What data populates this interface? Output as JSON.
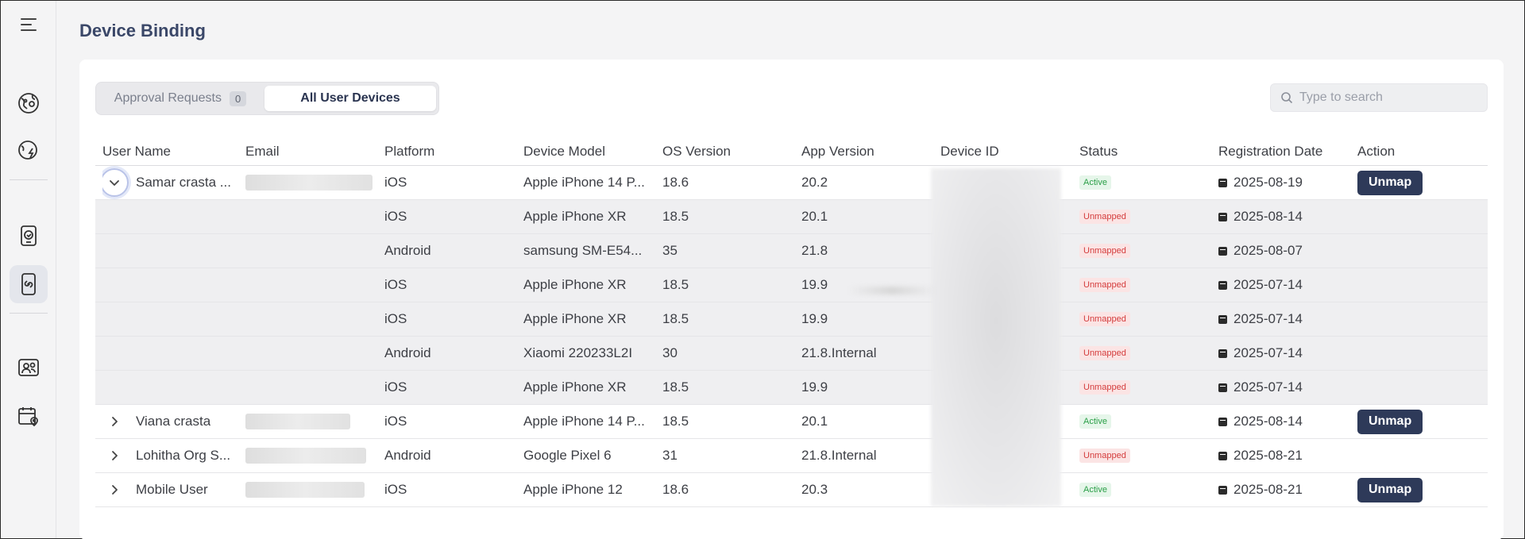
{
  "sidebar": {
    "icons": [
      "menu-icon",
      "globe-pin-icon",
      "globe-bolt-icon",
      "phone-badge-icon",
      "phone-link-icon",
      "user-group-icon",
      "calendar-pin-icon"
    ]
  },
  "page": {
    "title": "Device Binding"
  },
  "tabs": {
    "approval_label": "Approval Requests",
    "approval_count": "0",
    "all_label": "All User Devices"
  },
  "search": {
    "placeholder": "Type to search"
  },
  "table": {
    "headers": {
      "user": "User Name",
      "email": "Email",
      "platform": "Platform",
      "model": "Device Model",
      "os": "OS Version",
      "app": "App Version",
      "device": "Device ID",
      "status": "Status",
      "date": "Registration Date",
      "action": "Action"
    },
    "rows": [
      {
        "user": "Samar crasta ...",
        "platform": "iOS",
        "model": "Apple iPhone 14 P...",
        "os": "18.6",
        "app": "20.2",
        "status": "Active",
        "date": "2025-08-19",
        "action": "Unmap"
      },
      {
        "user": "",
        "platform": "iOS",
        "model": "Apple iPhone XR",
        "os": "18.5",
        "app": "20.1",
        "status": "Unmapped",
        "date": "2025-08-14",
        "action": ""
      },
      {
        "user": "",
        "platform": "Android",
        "model": "samsung SM-E54...",
        "os": "35",
        "app": "21.8",
        "status": "Unmapped",
        "date": "2025-08-07",
        "action": ""
      },
      {
        "user": "",
        "platform": "iOS",
        "model": "Apple iPhone XR",
        "os": "18.5",
        "app": "19.9",
        "status": "Unmapped",
        "date": "2025-07-14",
        "action": ""
      },
      {
        "user": "",
        "platform": "iOS",
        "model": "Apple iPhone XR",
        "os": "18.5",
        "app": "19.9",
        "status": "Unmapped",
        "date": "2025-07-14",
        "action": ""
      },
      {
        "user": "",
        "platform": "Android",
        "model": "Xiaomi 220233L2I",
        "os": "30",
        "app": "21.8.Internal",
        "status": "Unmapped",
        "date": "2025-07-14",
        "action": ""
      },
      {
        "user": "",
        "platform": "iOS",
        "model": "Apple iPhone XR",
        "os": "18.5",
        "app": "19.9",
        "status": "Unmapped",
        "date": "2025-07-14",
        "action": ""
      },
      {
        "user": "Viana crasta",
        "platform": "iOS",
        "model": "Apple iPhone 14 P...",
        "os": "18.5",
        "app": "20.1",
        "status": "Active",
        "date": "2025-08-14",
        "action": "Unmap"
      },
      {
        "user": "Lohitha Org S...",
        "platform": "Android",
        "model": "Google Pixel 6",
        "os": "31",
        "app": "21.8.Internal",
        "status": "Unmapped",
        "date": "2025-08-21",
        "action": ""
      },
      {
        "user": "Mobile User",
        "platform": "iOS",
        "model": "Apple iPhone 12",
        "os": "18.6",
        "app": "20.3",
        "status": "Active",
        "date": "2025-08-21",
        "action": "Unmap"
      }
    ]
  },
  "colors": {
    "accent": "#2e3a59",
    "title": "#3a4768",
    "active_text": "#2a9f47",
    "active_bg": "#e6f6ea",
    "unmapped_text": "#d43c3c",
    "unmapped_bg": "#fbe4e4"
  }
}
